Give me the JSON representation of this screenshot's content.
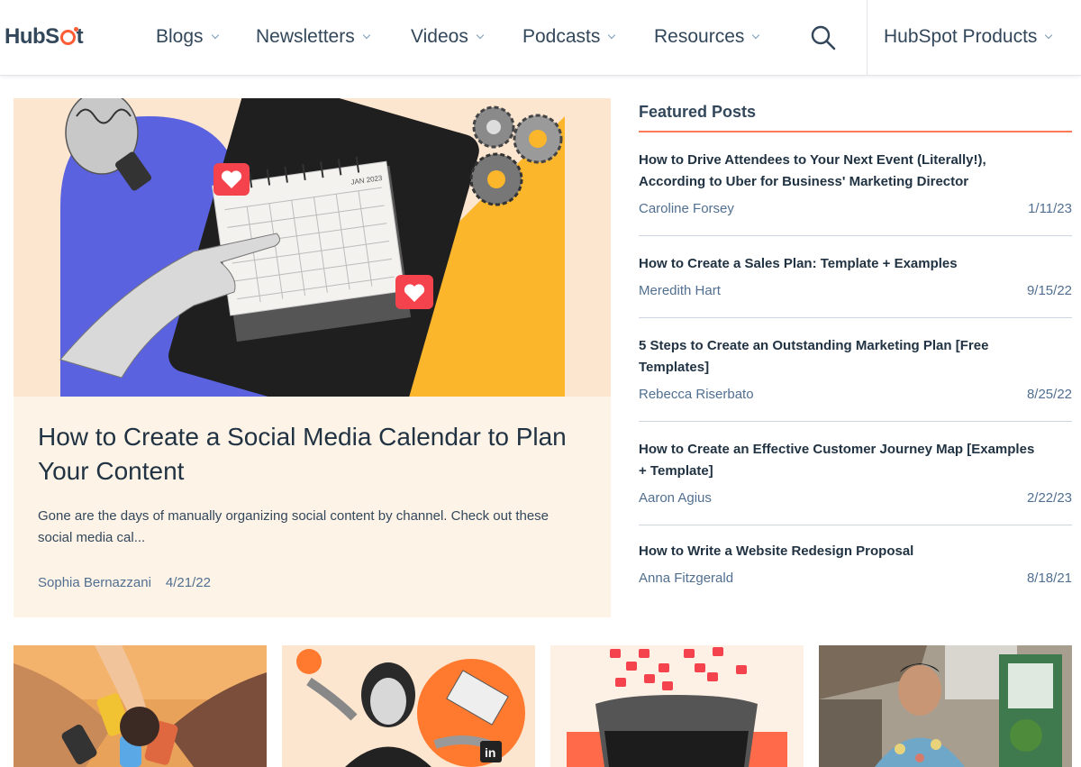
{
  "header": {
    "logo": "HubSpot",
    "nav": [
      {
        "label": "Blogs"
      },
      {
        "label": "Newsletters"
      },
      {
        "label": "Videos"
      },
      {
        "label": "Podcasts"
      },
      {
        "label": "Resources"
      }
    ],
    "search_icon": "search-icon",
    "products_label": "HubSpot Products"
  },
  "hero": {
    "image_text": "JAN 2023",
    "title": "How to Create a Social Media Calendar to Plan Your Content",
    "excerpt": "Gone are the days of manually organizing social content by channel. Check out these social media cal...",
    "author": "Sophia Bernazzani",
    "date": "4/21/22"
  },
  "featured": {
    "heading": "Featured Posts",
    "posts": [
      {
        "title": "How to Drive Attendees to Your Next Event (Literally!), According to Uber for Business' Marketing Director",
        "author": "Caroline Forsey",
        "date": "1/11/23"
      },
      {
        "title": "How to Create a Sales Plan: Template + Examples",
        "author": "Meredith Hart",
        "date": "9/15/22"
      },
      {
        "title": "5 Steps to Create an Outstanding Marketing Plan [Free Templates]",
        "author": "Rebecca Riserbato",
        "date": "8/25/22"
      },
      {
        "title": "How to Create an Effective Customer Journey Map [Examples + Template]",
        "author": "Aaron Agius",
        "date": "2/22/23"
      },
      {
        "title": "How to Write a Website Redesign Proposal",
        "author": "Anna Fitzgerald",
        "date": "8/18/21"
      }
    ]
  },
  "colors": {
    "text_dark": "#213343",
    "text_body": "#33475b",
    "text_muted": "#516f90",
    "accent": "#ff7a59",
    "card_bg": "#fdf3e7"
  }
}
